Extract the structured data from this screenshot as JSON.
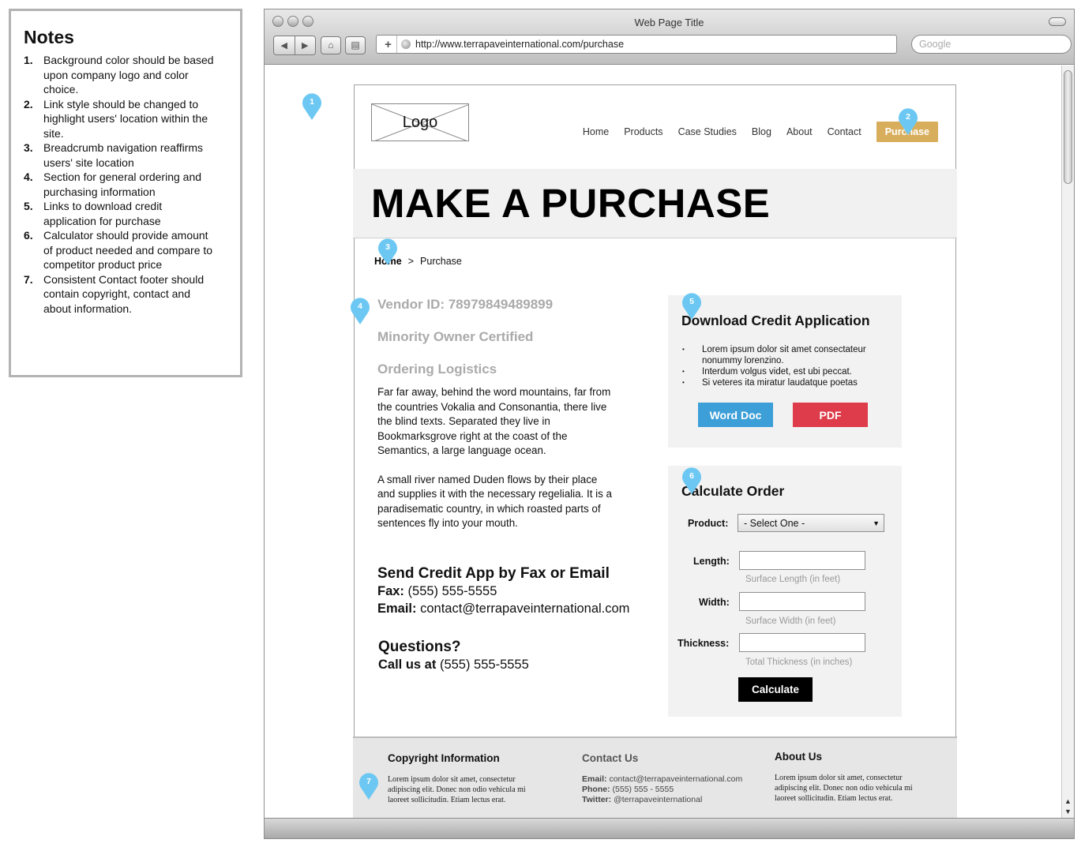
{
  "notes": {
    "title": "Notes",
    "items": [
      {
        "num": "1.",
        "text": "Background color should be based upon company logo and color choice."
      },
      {
        "num": "2.",
        "text": "Link style should be changed to highlight users' location within the site."
      },
      {
        "num": "3.",
        "text": "Breadcrumb navigation reaffirms users' site location"
      },
      {
        "num": "4.",
        "text": "Section for general ordering and purchasing information"
      },
      {
        "num": "5.",
        "text": "Links to download credit application for purchase"
      },
      {
        "num": "6.",
        "text": "Calculator should provide amount of product needed and compare to competitor product price"
      },
      {
        "num": "7.",
        "text": "Consistent Contact footer should contain copyright, contact and about information."
      }
    ]
  },
  "browser": {
    "window_title": "Web Page Title",
    "url": "http://www.terrapaveinternational.com/purchase",
    "search_placeholder": "Google"
  },
  "header": {
    "logo_text": "Logo",
    "nav": [
      "Home",
      "Products",
      "Case Studies",
      "Blog",
      "About",
      "Contact",
      "Purchase"
    ],
    "active_nav": "Purchase",
    "accent_color": "#d8ae5c"
  },
  "hero": {
    "title": "MAKE A PURCHASE"
  },
  "breadcrumb": {
    "home": "Home",
    "separator": ">",
    "current": "Purchase"
  },
  "main": {
    "vendor_id": "Vendor ID: 78979849489899",
    "certified": "Minority Owner Certified",
    "ordering_heading": "Ordering Logistics",
    "paragraph1": "Far far away, behind the word mountains, far from the countries Vokalia and Consonantia, there live the blind texts. Separated they live in Bookmarksgrove right at the coast of the Semantics, a large language ocean.",
    "paragraph2": "A small river named Duden flows by their place and supplies it with the necessary regelialia. It is a paradisematic country, in which roasted parts of sentences fly into your mouth.",
    "fax_heading": "Send Credit App by Fax or Email",
    "fax_label": "Fax:",
    "fax_value": "(555) 555-5555",
    "email_label": "Email:",
    "email_value": "contact@terrapaveinternational.com",
    "questions_heading": "Questions?",
    "call_label": "Call us at",
    "call_value": "(555) 555-5555"
  },
  "download": {
    "heading": "Download Credit Application",
    "bullets": [
      "Lorem ipsum dolor sit amet consectateur nonummy lorenzino.",
      "Interdum volgus videt, est ubi peccat.",
      "Si veteres ita miratur laudatque poetas"
    ],
    "word_label": "Word Doc",
    "pdf_label": "PDF",
    "word_color": "#3d9fd8",
    "pdf_color": "#de3b4b"
  },
  "calculator": {
    "heading": "Calculate Order",
    "product_label": "Product:",
    "product_selected": "- Select One -",
    "length_label": "Length:",
    "length_hint": "Surface Length (in feet)",
    "width_label": "Width:",
    "width_hint": "Surface Width (in feet)",
    "thickness_label": "Thickness:",
    "thickness_hint": "Total Thickness (in inches)",
    "button_label": "Calculate"
  },
  "footer": {
    "copyright_heading": "Copyright Information",
    "copyright_text": "Lorem ipsum dolor sit amet, consectetur adipiscing elit. Donec non odio vehicula mi laoreet sollicitudin. Etiam lectus erat.",
    "contact_heading": "Contact Us",
    "email_label": "Email:",
    "email_value": "contact@terrapaveinternational.com",
    "phone_label": "Phone:",
    "phone_value": "(555) 555 - 5555",
    "twitter_label": "Twitter:",
    "twitter_value": "@terrapaveinternational",
    "about_heading": "About Us",
    "about_text": "Lorem ipsum dolor sit amet, consectetur adipiscing elit. Donec non odio vehicula mi laoreet sollicitudin. Etiam lectus erat."
  },
  "markers": [
    "1",
    "2",
    "3",
    "4",
    "5",
    "6",
    "7"
  ],
  "marker_color": "#6cc8f2"
}
